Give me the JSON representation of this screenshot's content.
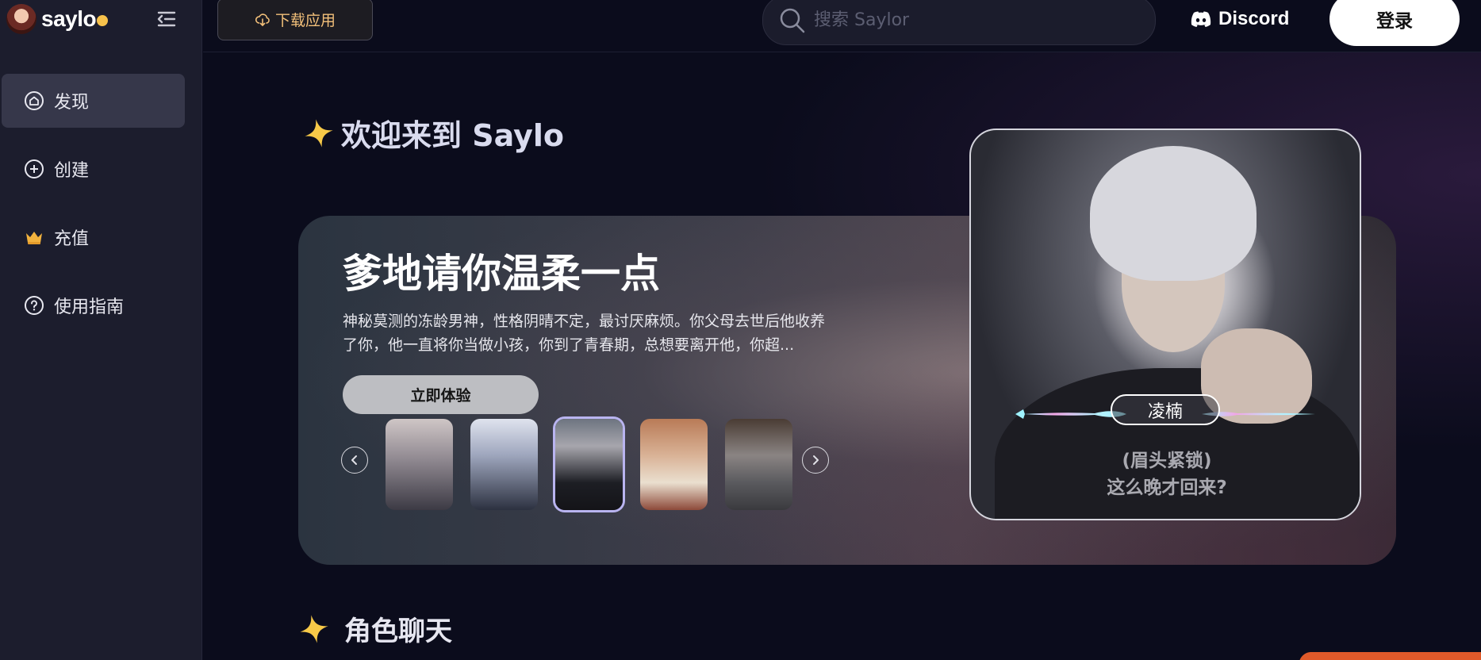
{
  "app": {
    "brand": "saylo"
  },
  "sidebar": {
    "items": [
      {
        "label": "发现",
        "icon": "home-icon",
        "active": true
      },
      {
        "label": "创建",
        "icon": "plus-circle-icon",
        "active": false
      },
      {
        "label": "充值",
        "icon": "crown-icon",
        "active": false
      },
      {
        "label": "使用指南",
        "icon": "help-circle-icon",
        "active": false
      }
    ]
  },
  "topbar": {
    "download_label": "下载应用",
    "search_placeholder": "搜索 Saylor",
    "discord_label": "Discord",
    "login_label": "登录"
  },
  "welcome": {
    "title": "欢迎来到 Saylo"
  },
  "hero": {
    "title": "爹地请你温柔一点",
    "description": "神秘莫测的冻龄男神，性格阴晴不定，最讨厌麻烦。你父母去世后他收养了你，他一直将你当做小孩，你到了青春期，总想要离开他，你超...",
    "cta_label": "立即体验",
    "thumbnails": [
      {
        "name": "character-1",
        "selected": false
      },
      {
        "name": "character-2",
        "selected": false
      },
      {
        "name": "character-3",
        "selected": true
      },
      {
        "name": "character-4",
        "selected": false
      },
      {
        "name": "character-5",
        "selected": false
      }
    ]
  },
  "character_card": {
    "name": "凌楠",
    "dialogue_line1": "(眉头紧锁)",
    "dialogue_line2": "这么晚才回来?"
  },
  "section": {
    "title": "角色聊天"
  },
  "colors": {
    "sidebar_bg": "#1c1d2d",
    "page_bg": "#0b0c1c",
    "download_accent": "#f3c07a",
    "brand_dot": "#f7c14b",
    "selected_thumb": "#b9b4f0"
  }
}
